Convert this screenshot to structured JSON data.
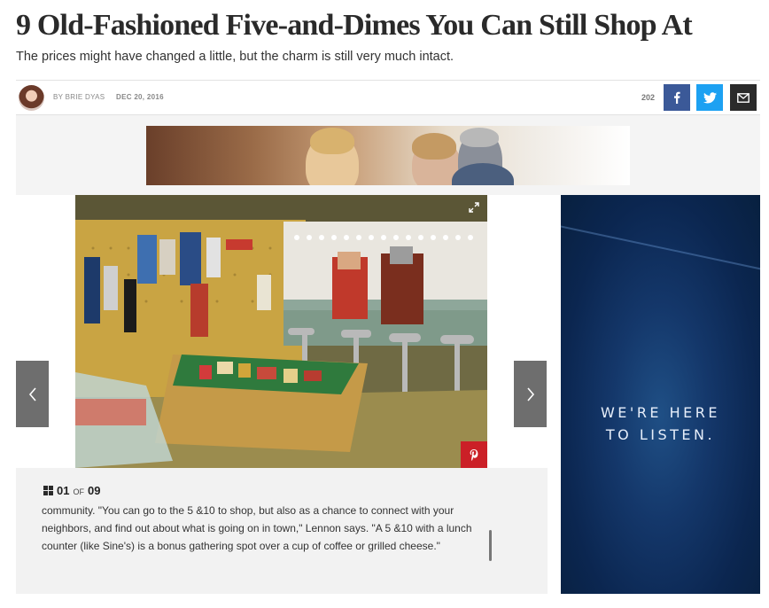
{
  "article": {
    "title": "9 Old-Fashioned Five-and-Dimes You Can Still Shop At",
    "dek": "The prices might have changed a little, but the charm is still very much intact.",
    "byline": "BY BRIE DYAS",
    "date": "DEC 20, 2016",
    "share_count": "202"
  },
  "share": {
    "icons": [
      "facebook-icon",
      "twitter-icon",
      "email-icon"
    ],
    "colors": {
      "facebook": "#3b5998",
      "twitter": "#1da1f2",
      "email": "#2b2b2b"
    }
  },
  "gallery": {
    "current": "01",
    "of_label": "OF",
    "total": "09",
    "caption": "community. \"You can go to the 5 &10 to shop, but also as a chance to connect with your neighbors, and find out about what is going on in town,\" Lennon says. \"A 5 &10 with a lunch counter (like Sine's) is a bonus gathering spot over a cup of coffee or grilled cheese.\"",
    "icons": [
      "expand-icon",
      "pinterest-icon",
      "chevron-left-icon",
      "chevron-right-icon",
      "grid-icon"
    ],
    "pin_color": "#cb2027"
  },
  "side_ad": {
    "line1": "WE'RE HERE",
    "line2": "TO LISTEN."
  }
}
